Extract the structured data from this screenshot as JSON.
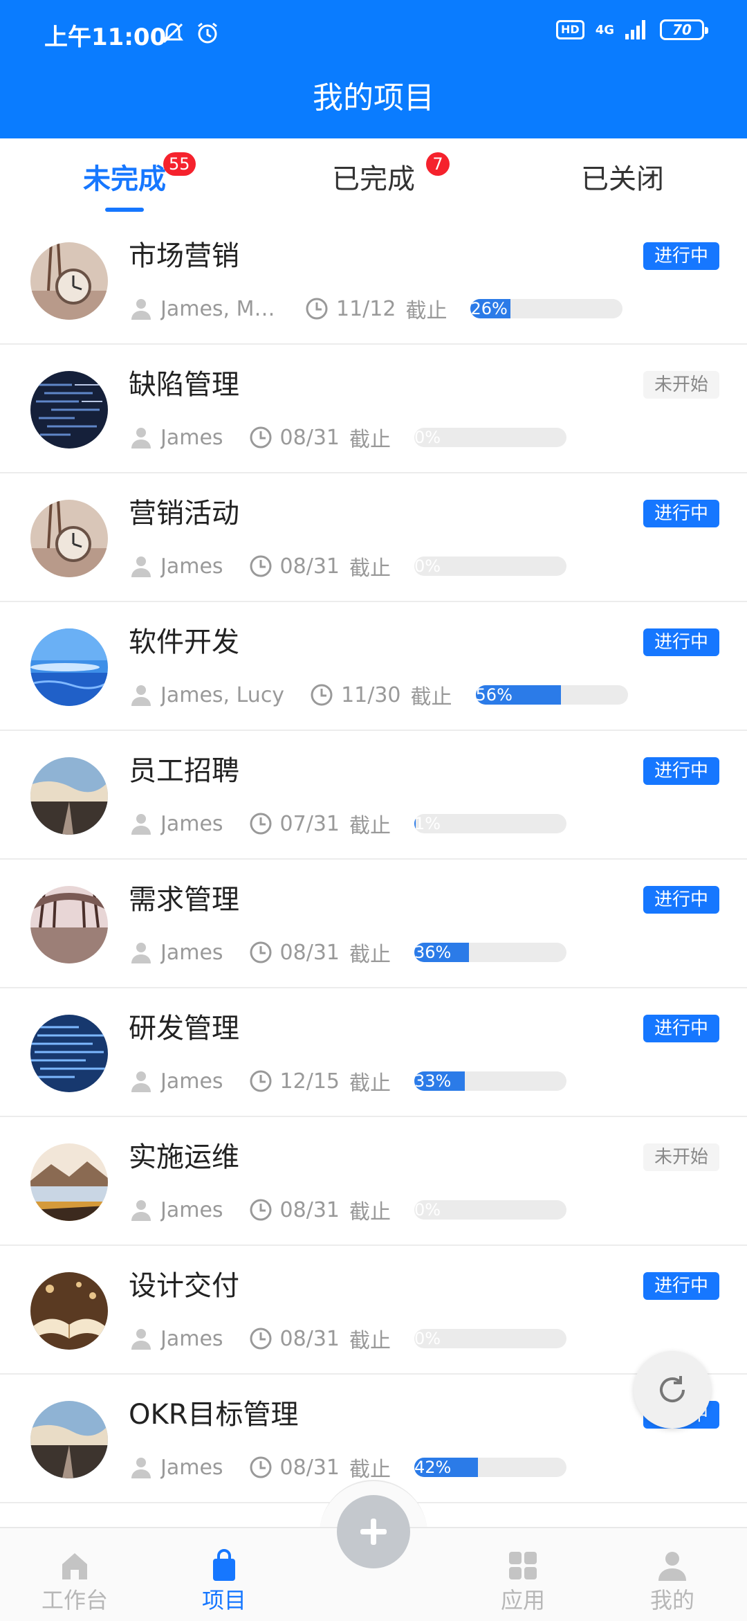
{
  "status_bar": {
    "time": "上午11:00",
    "hd": "HD",
    "network": "4G",
    "battery": "70"
  },
  "header": {
    "title": "我的项目"
  },
  "tabs": [
    {
      "label": "未完成",
      "badge": "55",
      "active": true
    },
    {
      "label": "已完成",
      "badge": "7",
      "active": false
    },
    {
      "label": "已关闭",
      "badge": "",
      "active": false
    }
  ],
  "projects": [
    {
      "name": "市场营销",
      "status": "进行中",
      "people": "James, Miles,…",
      "due": "11/12",
      "due_label": "截止",
      "progress": 26,
      "progress_label": "26%",
      "avatar": "clock-eiffel"
    },
    {
      "name": "缺陷管理",
      "status": "未开始",
      "people": "James",
      "due": "08/31",
      "due_label": "截止",
      "progress": 0,
      "progress_label": "0%",
      "avatar": "code-screen"
    },
    {
      "name": "营销活动",
      "status": "进行中",
      "people": "James",
      "due": "08/31",
      "due_label": "截止",
      "progress": 0,
      "progress_label": "0%",
      "avatar": "clock-eiffel"
    },
    {
      "name": "软件开发",
      "status": "进行中",
      "people": "James, Lucy",
      "due": "11/30",
      "due_label": "截止",
      "progress": 56,
      "progress_label": "56%",
      "avatar": "sky-sea"
    },
    {
      "name": "员工招聘",
      "status": "进行中",
      "people": "James",
      "due": "07/31",
      "due_label": "截止",
      "progress": 1,
      "progress_label": "1%",
      "avatar": "road-clouds"
    },
    {
      "name": "需求管理",
      "status": "进行中",
      "people": "James",
      "due": "08/31",
      "due_label": "截止",
      "progress": 36,
      "progress_label": "36%",
      "avatar": "tree-alley"
    },
    {
      "name": "研发管理",
      "status": "进行中",
      "people": "James",
      "due": "12/15",
      "due_label": "截止",
      "progress": 33,
      "progress_label": "33%",
      "avatar": "code-blue"
    },
    {
      "name": "实施运维",
      "status": "未开始",
      "people": "James",
      "due": "08/31",
      "due_label": "截止",
      "progress": 0,
      "progress_label": "0%",
      "avatar": "lake-mountain"
    },
    {
      "name": "设计交付",
      "status": "进行中",
      "people": "James",
      "due": "08/31",
      "due_label": "截止",
      "progress": 0,
      "progress_label": "0%",
      "avatar": "open-book"
    },
    {
      "name": "OKR目标管理",
      "status": "进行中",
      "people": "James",
      "due": "08/31",
      "due_label": "截止",
      "progress": 42,
      "progress_label": "42%",
      "avatar": "road-clouds"
    }
  ],
  "bottom_nav": [
    {
      "label": "工作台",
      "icon": "home-icon",
      "active": false
    },
    {
      "label": "项目",
      "icon": "bag-icon",
      "active": true
    },
    {
      "label": "",
      "icon": "add-icon",
      "active": false
    },
    {
      "label": "应用",
      "icon": "grid-icon",
      "active": false
    },
    {
      "label": "我的",
      "icon": "person-icon",
      "active": false
    }
  ],
  "colors": {
    "accent": "#1677ff",
    "header": "#0a7cff",
    "badge": "#f5222d",
    "progress": "#2b7be8"
  }
}
